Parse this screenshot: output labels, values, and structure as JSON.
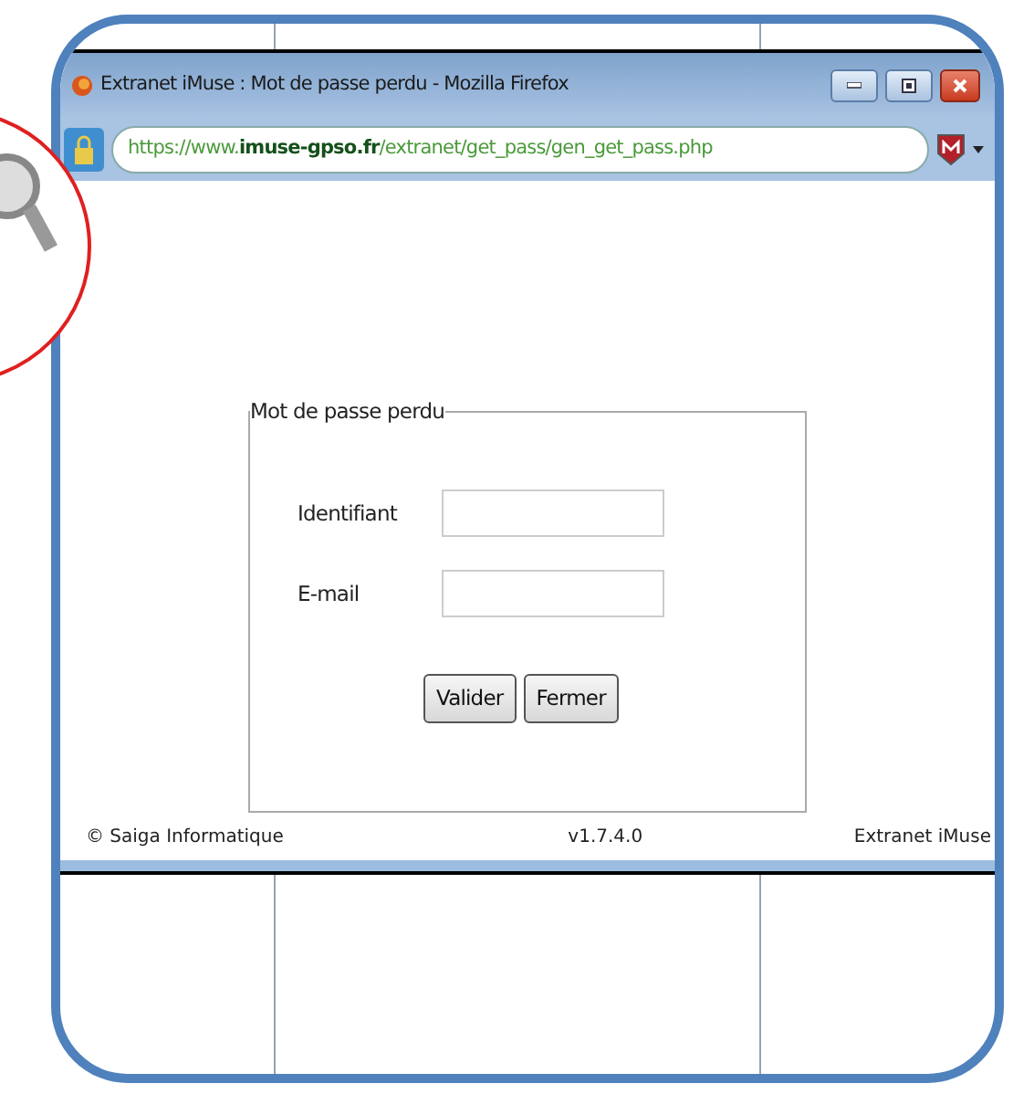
{
  "window": {
    "title": "Extranet iMuse : Mot de passe perdu - Mozilla Firefox"
  },
  "address_bar": {
    "url": "https://www.**imuse-gpso.fr**/extranet/get_pass/gen_get_pass.php"
  },
  "form": {
    "legend": "Mot de passe perdu",
    "fields": [
      {
        "label": "Identifiant"
      },
      {
        "label": "E-mail"
      }
    ],
    "buttons": [
      "Valider",
      "Fermer"
    ]
  },
  "footer": {
    "left": "© Saiga Informatique",
    "center": "v1.7.4.0",
    "right": "Extranet iMuse"
  }
}
